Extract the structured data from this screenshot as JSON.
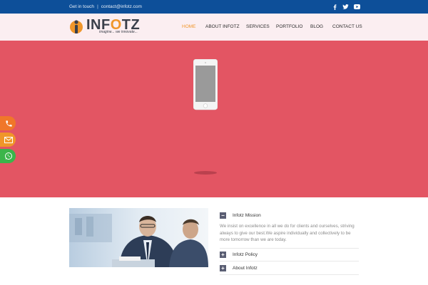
{
  "topbar": {
    "get_in_touch": "Get in touch",
    "separator": "|",
    "email": "contact@infotz.com",
    "social": [
      "facebook-icon",
      "twitter-icon",
      "youtube-icon"
    ]
  },
  "brand": {
    "name_part1": "INF",
    "name_o": "O",
    "name_part2": "TZ",
    "tagline": "imagine... we innovate..."
  },
  "nav": {
    "items": [
      "HOME",
      "ABOUT INFOTZ",
      "SERVICES",
      "PORTFOLIO",
      "BLOG",
      "CONTACT US"
    ],
    "active": "HOME"
  },
  "floating_buttons": [
    "phone-icon",
    "mail-icon",
    "whatsapp-icon"
  ],
  "accordion": [
    {
      "toggle": "−",
      "title": "Infotz Mission",
      "expanded": true,
      "body": "We insist on excellence in all we do for clients and ourselves, striving always to give our best.We aspire individually and collectively to be more tomorrow than we are today."
    },
    {
      "toggle": "+",
      "title": "Infotz Policy",
      "expanded": false
    },
    {
      "toggle": "+",
      "title": "About Infotz",
      "expanded": false
    }
  ],
  "colors": {
    "topbar": "#0d4f99",
    "header": "#fbeef1",
    "hero": "#e35563",
    "accent": "#f0962a",
    "phone_button": "#f0772a",
    "mail_button": "#f0962a",
    "whatsapp_button": "#3bb54a"
  }
}
